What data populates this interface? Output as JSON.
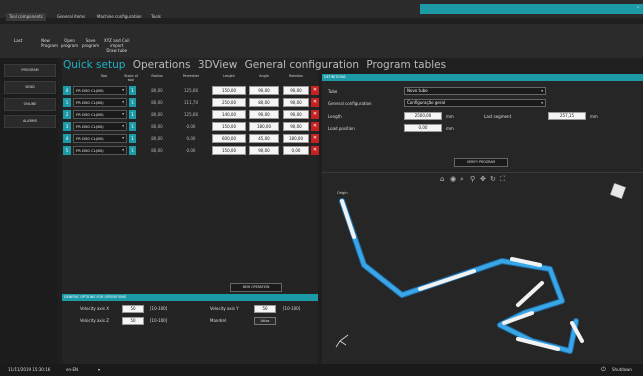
{
  "menu": {
    "tabs": [
      "Tool components",
      "General items",
      "Machine configuration",
      "Tools"
    ]
  },
  "toolbar": {
    "items": [
      {
        "label": "Last",
        "sub": ""
      },
      {
        "label": "New",
        "sub": "Program"
      },
      {
        "label": "Open",
        "sub": "program"
      },
      {
        "label": "Save",
        "sub": "program"
      },
      {
        "label": "XYZ and Coil",
        "sub": "import"
      },
      {
        "label": "",
        "sub": "Draw tube"
      }
    ]
  },
  "sidebar": {
    "items": [
      "PROGRAM",
      "SEND",
      "ONLINE",
      "ALARMS"
    ]
  },
  "tabs": [
    "Quick setup",
    "Operations",
    "3DView",
    "General configuration",
    "Program tables"
  ],
  "table": {
    "headers": [
      "Tool",
      "Stack of tool",
      "Radius",
      "Perimeter",
      "Length",
      "Angle",
      "Rotation"
    ],
    "rows": [
      {
        "idx": "0",
        "tool": "FR D50 CL(80)",
        "stack": "1",
        "radius": "80,00",
        "perimeter": "125,66",
        "length": "150,00",
        "angle": "90,00",
        "rotation": "90,00"
      },
      {
        "idx": "1",
        "tool": "FR D50 CL(80)",
        "stack": "1",
        "radius": "80,00",
        "perimeter": "111,70",
        "length": "250,00",
        "angle": "80,00",
        "rotation": "90,00"
      },
      {
        "idx": "2",
        "tool": "FR D50 CL(80)",
        "stack": "1",
        "radius": "80,00",
        "perimeter": "125,66",
        "length": "140,00",
        "angle": "90,00",
        "rotation": "90,00"
      },
      {
        "idx": "3",
        "tool": "FR D50 CL(80)",
        "stack": "1",
        "radius": "80,00",
        "perimeter": "0,00",
        "length": "150,00",
        "angle": "180,00",
        "rotation": "90,00"
      },
      {
        "idx": "4",
        "tool": "FR D50 CL(80)",
        "stack": "1",
        "radius": "80,00",
        "perimeter": "0,00",
        "length": "600,00",
        "angle": "45,00",
        "rotation": "180,00"
      },
      {
        "idx": "5",
        "tool": "FR D50 CL(80)",
        "stack": "1",
        "radius": "80,00",
        "perimeter": "0,00",
        "length": "150,00",
        "angle": "90,00",
        "rotation": "0,00"
      }
    ],
    "new_operation": "NEW OPERATION"
  },
  "general_options": {
    "title": "GENERIC OPTIONS FOR OPERATIONS",
    "velocity_x_label": "Velocity axis X",
    "velocity_x": "50",
    "velocity_x_range": "[10-100]",
    "velocity_y_label": "Velocity axis Y",
    "velocity_y": "50",
    "velocity_y_range": "[10-100]",
    "velocity_z_label": "Velocity axis Z",
    "velocity_z": "50",
    "velocity_z_range": "[10-100]",
    "mandrel_label": "Mandrel",
    "mandrel_value": "Atlas"
  },
  "definitions": {
    "title": "DEFINITIONS",
    "tube_label": "Tube",
    "tube_value": "Novo tubo",
    "general_config_label": "General configuration",
    "general_config_value": "Configuração geral",
    "length_label": "Length",
    "length_value": "2500,00",
    "length_unit": "mm",
    "last_segment_label": "Last segment",
    "last_segment_value": "257,15",
    "last_segment_unit": "mm",
    "load_position_label": "Load position",
    "load_position_value": "0,00",
    "load_position_unit": "mm",
    "verify_program": "VERIFY PROGRAM"
  },
  "viewer": {
    "origin_label": "Origin"
  },
  "status": {
    "datetime": "11/11/2019 15:30:16",
    "language": "en-EN",
    "shutdown": "Shutdown"
  },
  "colors": {
    "accent": "#1d9aa8",
    "delete": "#c42121",
    "tube": "#2a8fd6"
  }
}
